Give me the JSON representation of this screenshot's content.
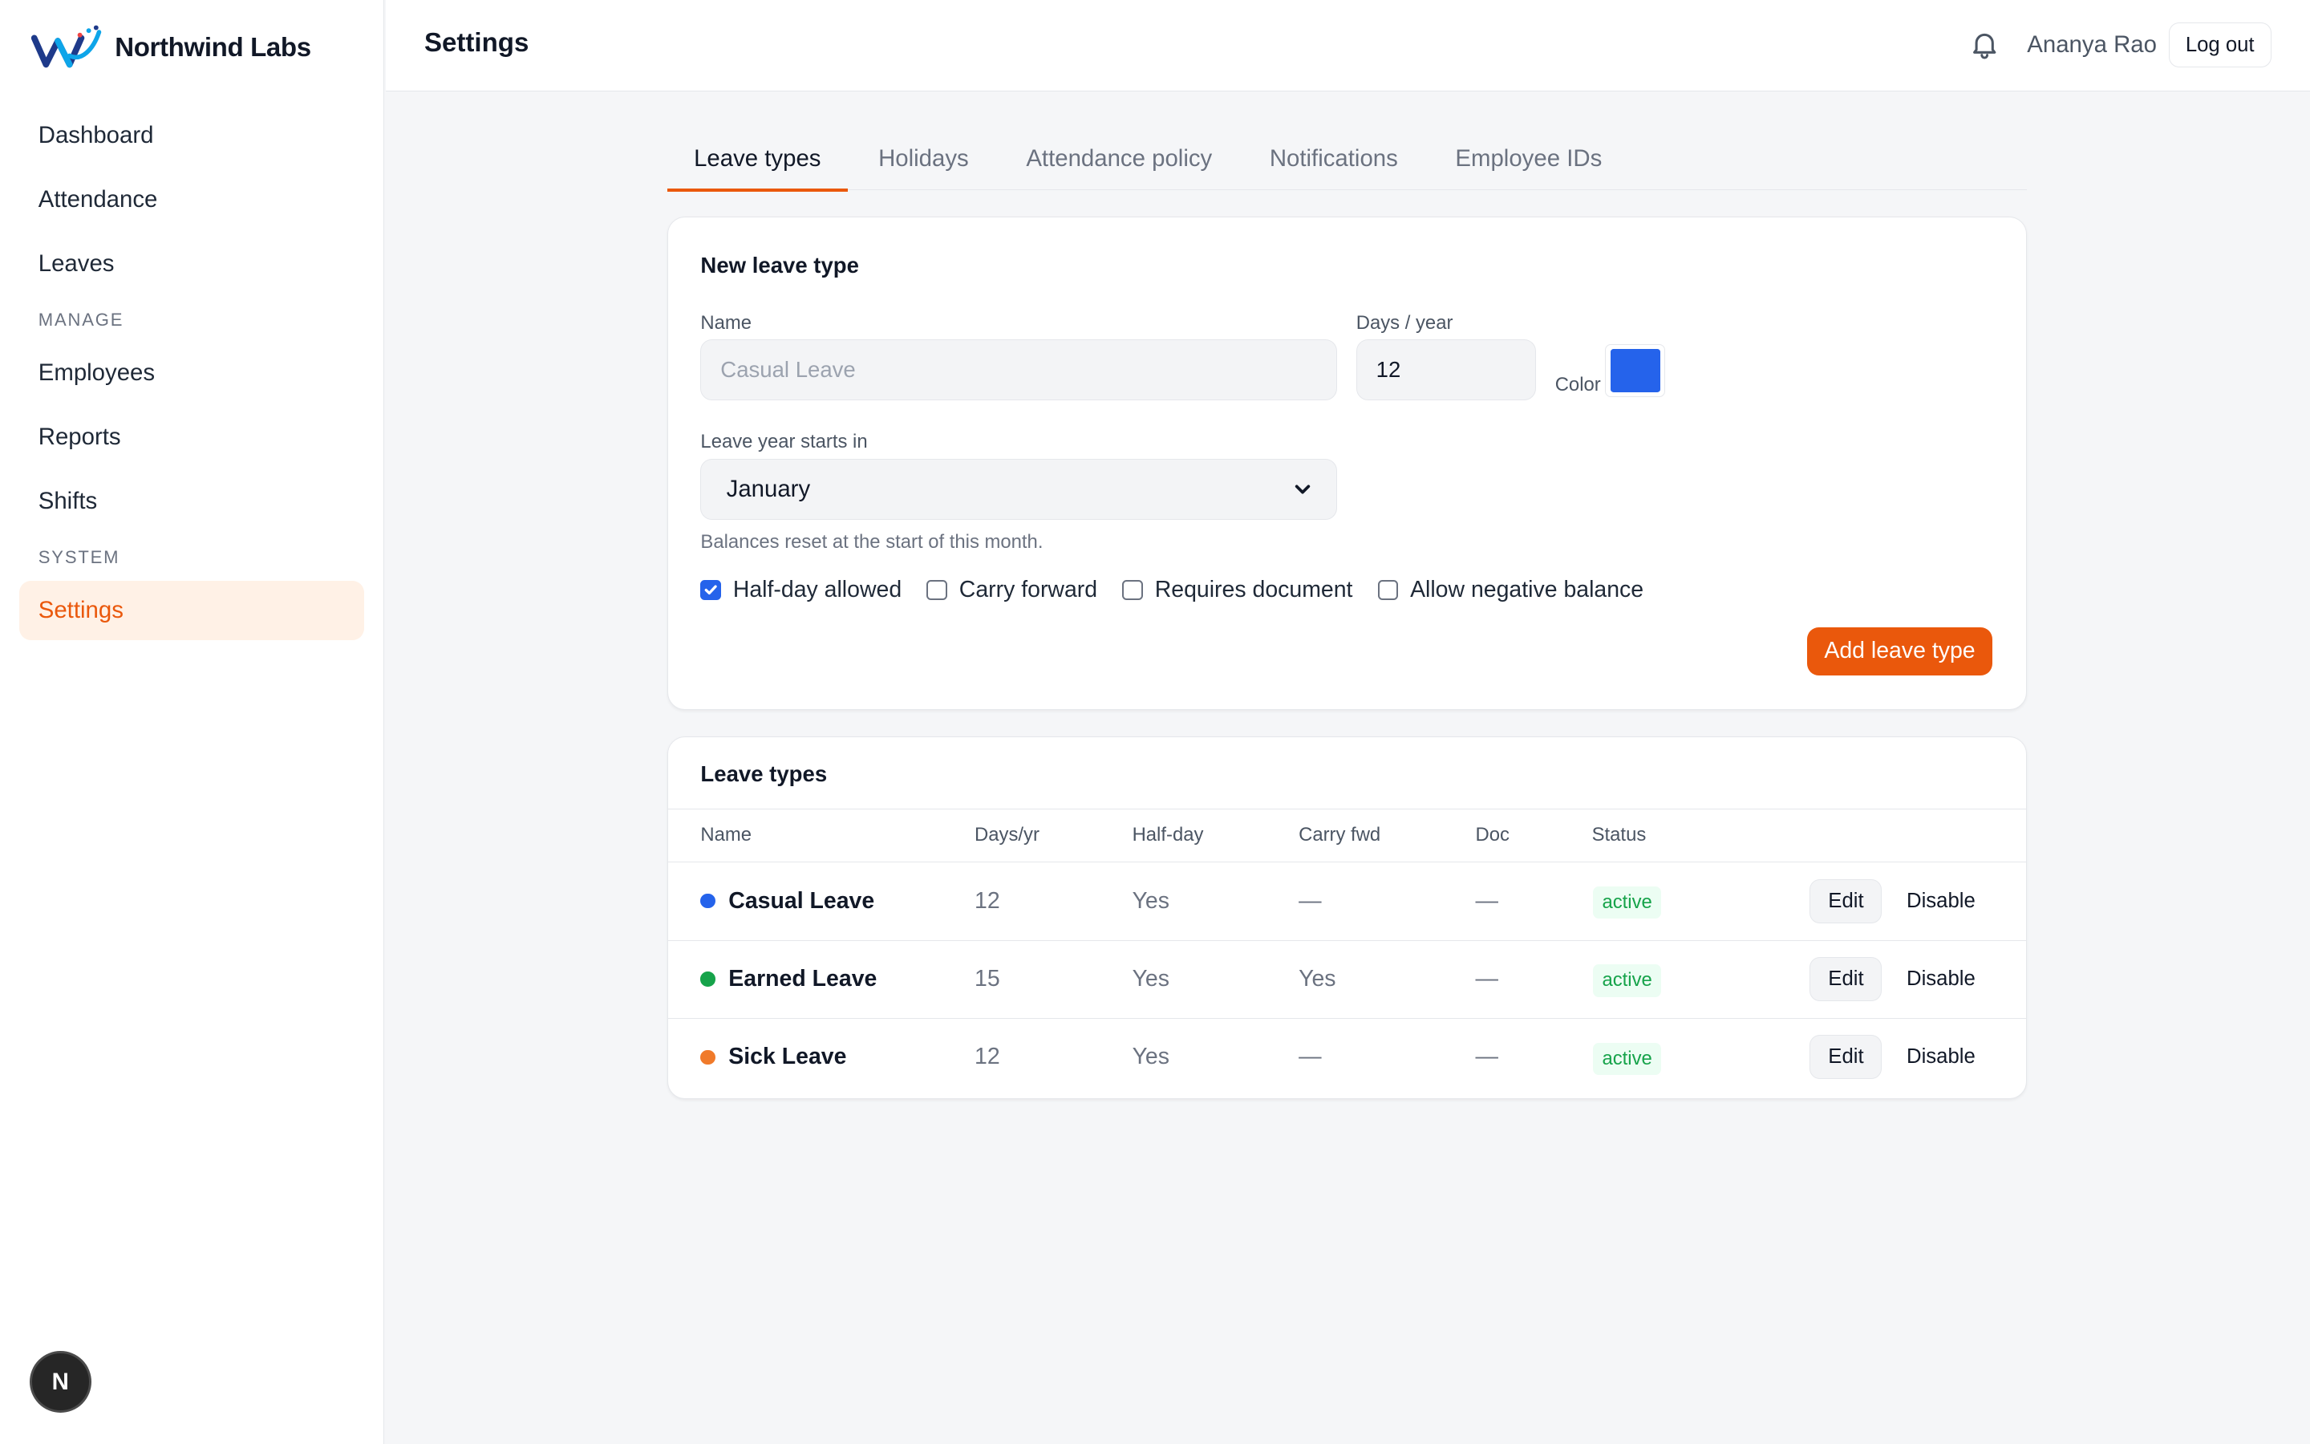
{
  "brand": {
    "name": "Northwind Labs",
    "logo_icon": "northwind-logo"
  },
  "sidebar": {
    "items_main": [
      {
        "label": "Dashboard",
        "key": "dashboard"
      },
      {
        "label": "Attendance",
        "key": "attendance"
      },
      {
        "label": "Leaves",
        "key": "leaves"
      }
    ],
    "section_manage": "MANAGE",
    "items_manage": [
      {
        "label": "Employees",
        "key": "employees"
      },
      {
        "label": "Reports",
        "key": "reports"
      },
      {
        "label": "Shifts",
        "key": "shifts"
      }
    ],
    "section_system": "SYSTEM",
    "items_system": [
      {
        "label": "Settings",
        "key": "settings",
        "active": true
      }
    ],
    "fab_label": "N"
  },
  "header": {
    "title": "Settings",
    "bell_icon": "bell-icon",
    "user_name": "Ananya Rao",
    "logout_label": "Log out"
  },
  "tabs": [
    {
      "label": "Leave types",
      "active": true
    },
    {
      "label": "Holidays"
    },
    {
      "label": "Attendance policy"
    },
    {
      "label": "Notifications"
    },
    {
      "label": "Employee IDs"
    }
  ],
  "form": {
    "title": "New leave type",
    "name_label": "Name",
    "name_placeholder": "Casual Leave",
    "name_value": "",
    "days_label": "Days / year",
    "days_value": "12",
    "color_label": "Color",
    "color_value": "#2563eb",
    "year_start_label": "Leave year starts in",
    "year_start_value": "January",
    "hint": "Balances reset at the start of this month.",
    "checkboxes": [
      {
        "label": "Half-day allowed",
        "checked": true
      },
      {
        "label": "Carry forward",
        "checked": false
      },
      {
        "label": "Requires document",
        "checked": false
      },
      {
        "label": "Allow negative balance",
        "checked": false
      }
    ],
    "submit_label": "Add leave type"
  },
  "list": {
    "title": "Leave types",
    "columns": [
      "Name",
      "Days/yr",
      "Half-day",
      "Carry fwd",
      "Doc",
      "Status"
    ],
    "rows": [
      {
        "name": "Casual Leave",
        "color": "#2563eb",
        "days": "12",
        "half_day": "Yes",
        "carry": "—",
        "doc": "—",
        "status": "active",
        "edit": "Edit",
        "disable": "Disable"
      },
      {
        "name": "Earned Leave",
        "color": "#16a34a",
        "days": "15",
        "half_day": "Yes",
        "carry": "Yes",
        "doc": "—",
        "status": "active",
        "edit": "Edit",
        "disable": "Disable"
      },
      {
        "name": "Sick Leave",
        "color": "#f07a2a",
        "days": "12",
        "half_day": "Yes",
        "carry": "—",
        "doc": "—",
        "status": "active",
        "edit": "Edit",
        "disable": "Disable"
      }
    ]
  },
  "colors": {
    "accent": "#ea580c",
    "accent_soft": "#fff1e6",
    "checkbox": "#2563eb",
    "active_badge": "#16a34a"
  }
}
